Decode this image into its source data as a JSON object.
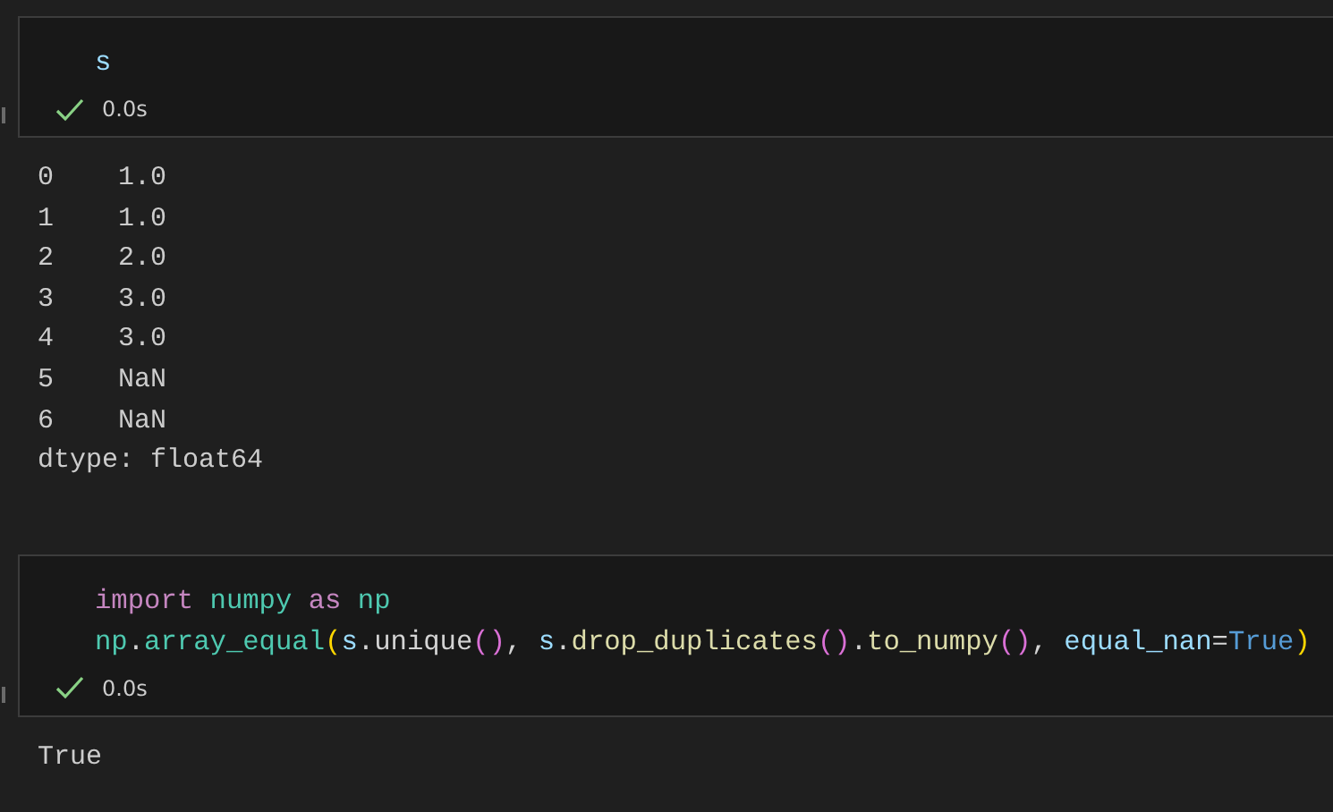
{
  "cells": [
    {
      "code": [
        [
          {
            "text": "s",
            "kind": "variable"
          }
        ]
      ],
      "status": {
        "succeeded": true,
        "time": "0.0s"
      },
      "output": [
        "0    1.0",
        "1    1.0",
        "2    2.0",
        "3    3.0",
        "4    3.0",
        "5    NaN",
        "6    NaN",
        "dtype: float64"
      ]
    },
    {
      "code": [
        [
          {
            "text": "import ",
            "kind": "keyword"
          },
          {
            "text": "numpy ",
            "kind": "module"
          },
          {
            "text": "as ",
            "kind": "keyword"
          },
          {
            "text": "np",
            "kind": "module"
          }
        ],
        [
          {
            "text": "np",
            "kind": "module"
          },
          {
            "text": ".",
            "kind": "plain"
          },
          {
            "text": "array_equal",
            "kind": "module"
          },
          {
            "text": "(",
            "kind": "bracket1"
          },
          {
            "text": "s",
            "kind": "variable"
          },
          {
            "text": ".unique",
            "kind": "plain"
          },
          {
            "text": "()",
            "kind": "bracket2"
          },
          {
            "text": ", ",
            "kind": "plain"
          },
          {
            "text": "s",
            "kind": "variable"
          },
          {
            "text": ".",
            "kind": "plain"
          },
          {
            "text": "drop_duplicates",
            "kind": "function"
          },
          {
            "text": "()",
            "kind": "bracket2"
          },
          {
            "text": ".",
            "kind": "plain"
          },
          {
            "text": "to_numpy",
            "kind": "function"
          },
          {
            "text": "()",
            "kind": "bracket2"
          },
          {
            "text": ", ",
            "kind": "plain"
          },
          {
            "text": "equal_nan",
            "kind": "variable"
          },
          {
            "text": "=",
            "kind": "plain"
          },
          {
            "text": "True",
            "kind": "constant"
          },
          {
            "text": ")",
            "kind": "bracket1"
          }
        ]
      ],
      "status": {
        "succeeded": true,
        "time": "0.0s"
      },
      "output": [
        "True"
      ]
    }
  ]
}
